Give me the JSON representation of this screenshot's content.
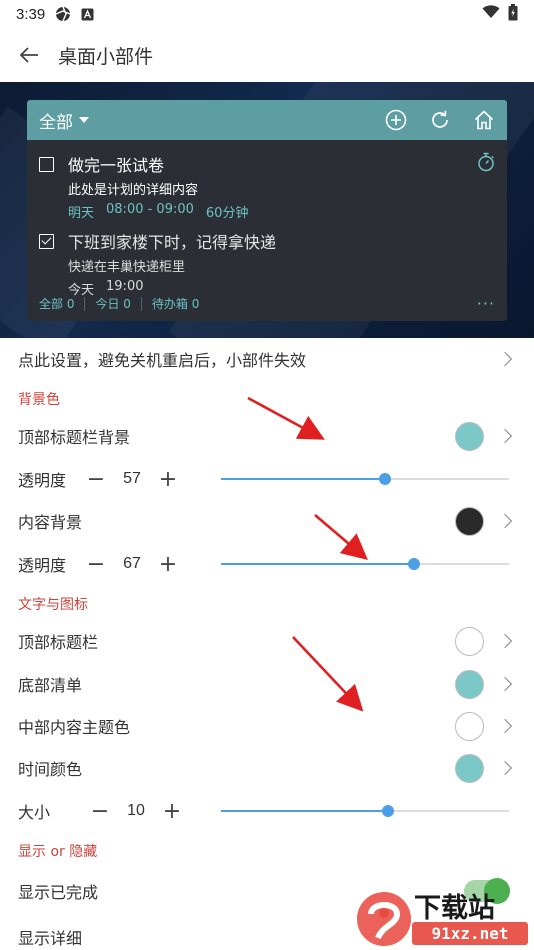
{
  "status_bar": {
    "time": "3:39"
  },
  "app_bar": {
    "title": "桌面小部件"
  },
  "widget": {
    "filter_label": "全部",
    "header_color": "#5e9ea3",
    "body_color": "#2b2f35",
    "tasks": [
      {
        "title": "做完一张试卷",
        "detail": "此处是计划的详细内容",
        "date": "明天",
        "time": "08:00 - 09:00",
        "duration": "60分钟",
        "checked": false
      },
      {
        "title": "下班到家楼下时，记得拿快递",
        "detail": "快递在丰巢快递柜里",
        "date": "今天",
        "time": "19:00",
        "checked": true
      }
    ],
    "footer": {
      "all": "全部 0",
      "today": "今日 0",
      "inbox": "待办箱 0"
    }
  },
  "settings": {
    "notice": "点此设置，避免关机重启后，小部件失效",
    "section_bg": "背景色",
    "top_bar_bg": {
      "label": "顶部标题栏背景",
      "color": "#7cc8c8"
    },
    "opacity1": {
      "label": "透明度",
      "value": "57",
      "percent": 57
    },
    "content_bg": {
      "label": "内容背景",
      "color": "#2a2a2a"
    },
    "opacity2": {
      "label": "透明度",
      "value": "67",
      "percent": 67
    },
    "section_text": "文字与图标",
    "top_bar_text": {
      "label": "顶部标题栏",
      "color": "#ffffff"
    },
    "bottom_list": {
      "label": "底部清单",
      "color": "#7cc8c8"
    },
    "middle_theme": {
      "label": "中部内容主题色",
      "color": "#ffffff"
    },
    "time_color": {
      "label": "时间颜色",
      "color": "#7cc8c8"
    },
    "size": {
      "label": "大小",
      "value": "10",
      "percent": 58
    },
    "section_show": "显示 or 隐藏",
    "show_completed": {
      "label": "显示已完成",
      "on": true
    },
    "show_detail": {
      "label": "显示详细"
    }
  },
  "watermark": {
    "text": "下载站",
    "site": "91xz.net"
  },
  "colors": {
    "accent": "#4c9ee6",
    "section": "#d0423a",
    "teal_text": "#6cc1c4",
    "arrow": "#e02020"
  }
}
